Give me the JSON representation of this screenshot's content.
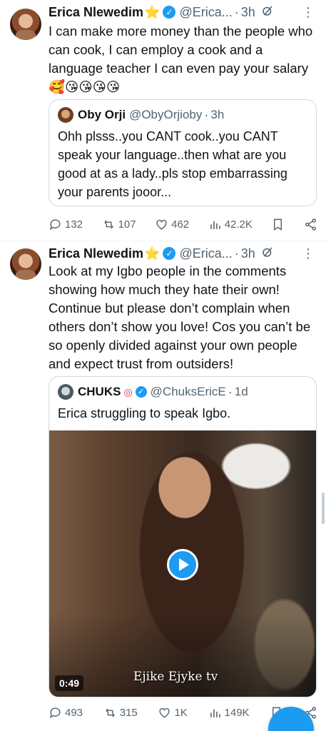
{
  "tweets": [
    {
      "author": "Erica Nlewedim",
      "badge_emoji": "⭐",
      "handle": "@Erica...",
      "time": "3h",
      "text": "I can make more money than the people who can cook, I can employ a cook and a language teacher I can even pay your salary🥰😘😘😘😘",
      "quote": {
        "author": "Oby Orji",
        "handle": "@ObyOrjioby",
        "time": "3h",
        "text": "Ohh plsss..you CANT cook..you CANT speak your language..then what are you good at as a lady..pls stop embarrassing your parents jooor..."
      },
      "stats": {
        "replies": "132",
        "reposts": "107",
        "likes": "462",
        "views": "42.2K"
      }
    },
    {
      "author": "Erica Nlewedim",
      "badge_emoji": "⭐",
      "handle": "@Erica...",
      "time": "3h",
      "text": "Look at my Igbo people in the comments showing how much they hate their own! Continue but please don’t complain when others don’t show you love! Cos you can’t be so openly divided against your own people and expect trust from outsiders!",
      "quote": {
        "author": "CHUKS",
        "handle": "@ChuksEricE",
        "time": "1d",
        "text": "Erica struggling to speak Igbo.",
        "video": {
          "duration": "0:49",
          "watermark": "Ejike Ejyke tv"
        }
      },
      "stats": {
        "replies": "493",
        "reposts": "315",
        "likes": "1K",
        "views": "149K"
      }
    }
  ],
  "symbols": {
    "dot": "·",
    "more": "⋮",
    "verified_check": "✓"
  },
  "colors": {
    "accent": "#1d9bf0",
    "muted": "#536471",
    "text": "#0f1419",
    "border": "#cfd9de"
  }
}
